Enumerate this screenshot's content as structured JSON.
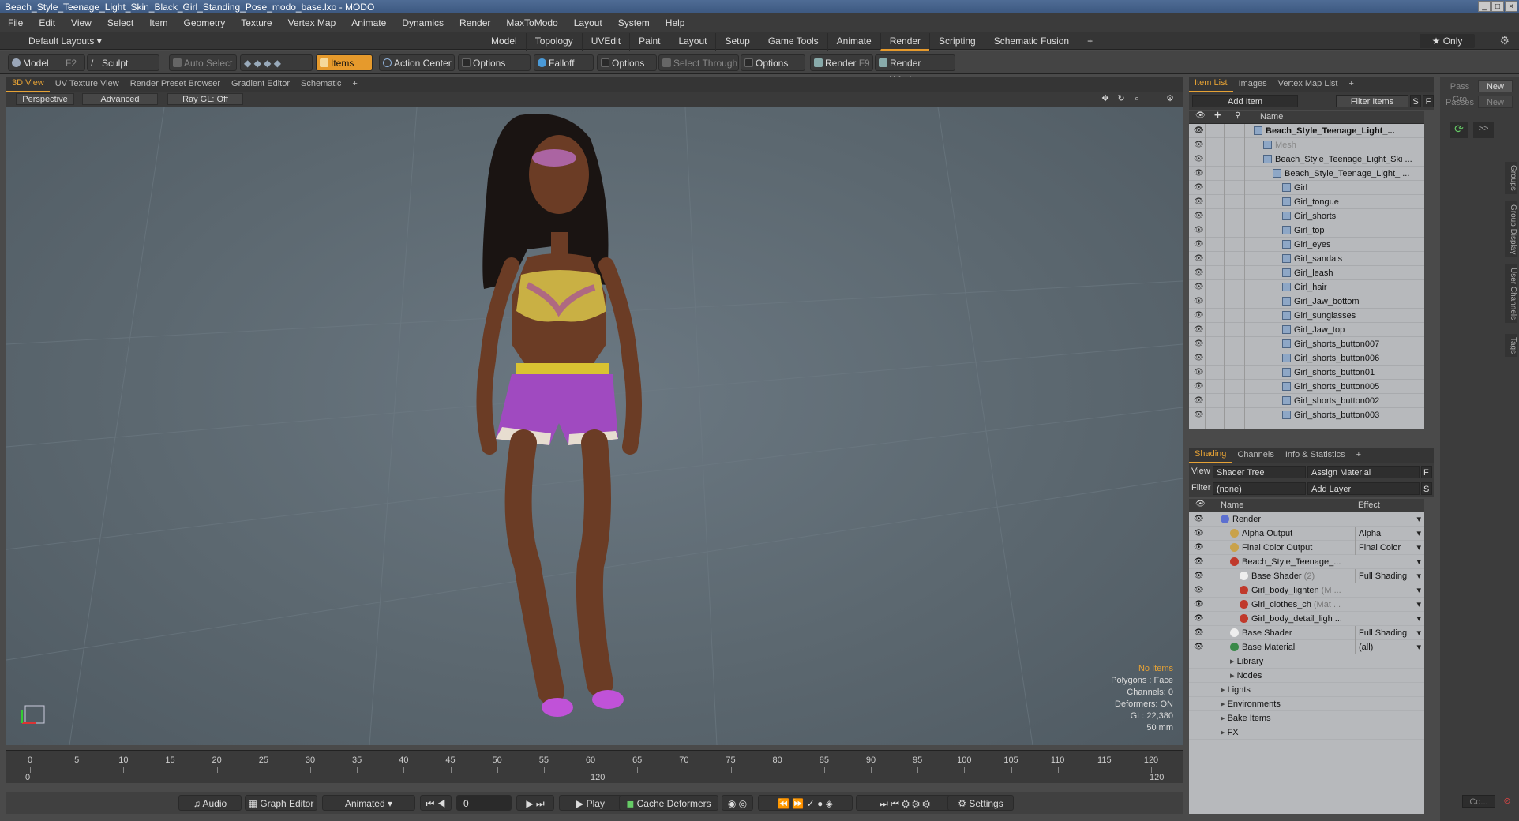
{
  "window": {
    "title": "Beach_Style_Teenage_Light_Skin_Black_Girl_Standing_Pose_modo_base.lxo - MODO"
  },
  "menu": [
    "File",
    "Edit",
    "View",
    "Select",
    "Item",
    "Geometry",
    "Texture",
    "Vertex Map",
    "Animate",
    "Dynamics",
    "Render",
    "MaxToModo",
    "Layout",
    "System",
    "Help"
  ],
  "layout_tabs": {
    "layouts_label": "Default Layouts ▾",
    "tabs": [
      "Model",
      "Topology",
      "UVEdit",
      "Paint",
      "Layout",
      "Setup",
      "Game Tools",
      "Animate",
      "Render",
      "Scripting",
      "Schematic Fusion",
      "+"
    ],
    "active": "Render",
    "only_label": "★ Only"
  },
  "toolbar": {
    "model": "Model",
    "model_key": "F2",
    "sculpt": "Sculpt",
    "auto_select": "Auto Select",
    "items": "Items",
    "action_center": "Action Center",
    "options1": "Options",
    "falloff": "Falloff",
    "options2": "Options",
    "select_through": "Select Through",
    "options3": "Options",
    "render": "Render",
    "render_key": "F9",
    "render_window": "Render Window"
  },
  "viewport": {
    "tabs": [
      "3D View",
      "UV Texture View",
      "Render Preset Browser",
      "Gradient Editor",
      "Schematic",
      "+"
    ],
    "active_tab": "3D View",
    "view_mode": "Perspective",
    "advanced": "Advanced",
    "raygl": "Ray GL: Off",
    "info": {
      "selection": "No Items",
      "polygons": "Polygons : Face",
      "channels": "Channels: 0",
      "deformers": "Deformers: ON",
      "gl": "GL: 22,380",
      "focal": "50 mm"
    }
  },
  "timeline": {
    "ticks": [
      0,
      5,
      10,
      15,
      20,
      25,
      30,
      35,
      40,
      45,
      50,
      55,
      60,
      65,
      70,
      75,
      80,
      85,
      90,
      95,
      100,
      105,
      110,
      115,
      120
    ],
    "range_start": "0",
    "range_mid": "120",
    "range_end": "120"
  },
  "playbar": {
    "audio": "Audio",
    "graph_editor": "Graph Editor",
    "animated": "Animated",
    "frame": "0",
    "play": "Play",
    "cache_deformers": "Cache Deformers",
    "settings": "Settings"
  },
  "item_list": {
    "tabs": [
      "Item List",
      "Images",
      "Vertex Map List",
      "+"
    ],
    "active_tab": "Item List",
    "add_item": "Add Item",
    "filter_items": "Filter Items",
    "s_btn": "S",
    "f_btn": "F",
    "col_name": "Name",
    "rows": [
      {
        "label": "Beach_Style_Teenage_Light_...",
        "depth": 0,
        "style": "b"
      },
      {
        "label": "Mesh",
        "depth": 1,
        "style": "d"
      },
      {
        "label": "Beach_Style_Teenage_Light_Ski ...",
        "depth": 1,
        "style": ""
      },
      {
        "label": "Beach_Style_Teenage_Light_ ...",
        "depth": 2,
        "style": ""
      },
      {
        "label": "Girl",
        "depth": 3,
        "style": ""
      },
      {
        "label": "Girl_tongue",
        "depth": 3,
        "style": ""
      },
      {
        "label": "Girl_shorts",
        "depth": 3,
        "style": ""
      },
      {
        "label": "Girl_top",
        "depth": 3,
        "style": ""
      },
      {
        "label": "Girl_eyes",
        "depth": 3,
        "style": ""
      },
      {
        "label": "Girl_sandals",
        "depth": 3,
        "style": ""
      },
      {
        "label": "Girl_leash",
        "depth": 3,
        "style": ""
      },
      {
        "label": "Girl_hair",
        "depth": 3,
        "style": ""
      },
      {
        "label": "Girl_Jaw_bottom",
        "depth": 3,
        "style": ""
      },
      {
        "label": "Girl_sunglasses",
        "depth": 3,
        "style": ""
      },
      {
        "label": "Girl_Jaw_top",
        "depth": 3,
        "style": ""
      },
      {
        "label": "Girl_shorts_button007",
        "depth": 3,
        "style": ""
      },
      {
        "label": "Girl_shorts_button006",
        "depth": 3,
        "style": ""
      },
      {
        "label": "Girl_shorts_button01",
        "depth": 3,
        "style": ""
      },
      {
        "label": "Girl_shorts_button005",
        "depth": 3,
        "style": ""
      },
      {
        "label": "Girl_shorts_button002",
        "depth": 3,
        "style": ""
      },
      {
        "label": "Girl_shorts_button003",
        "depth": 3,
        "style": ""
      }
    ]
  },
  "shading": {
    "tabs": [
      "Shading",
      "Channels",
      "Info & Statistics",
      "+"
    ],
    "active_tab": "Shading",
    "view_label": "View",
    "view_value": "Shader Tree",
    "assign_material": "Assign Material",
    "f_btn": "F",
    "filter_label": "Filter",
    "filter_value": "(none)",
    "add_layer": "Add Layer",
    "s_btn": "S",
    "col_name": "Name",
    "col_effect": "Effect",
    "rows": [
      {
        "label": "Render",
        "sub": "",
        "effect": "",
        "depth": 0,
        "ball": "#5b6fd0"
      },
      {
        "label": "Alpha Output",
        "sub": "",
        "effect": "Alpha",
        "depth": 1,
        "ball": "#c9a24a"
      },
      {
        "label": "Final Color Output",
        "sub": "",
        "effect": "Final Color",
        "depth": 1,
        "ball": "#c9a24a"
      },
      {
        "label": "Beach_Style_Teenage_...",
        "sub": "",
        "effect": "",
        "depth": 1,
        "ball": "#c0392b"
      },
      {
        "label": "Base Shader",
        "sub": "(2)",
        "effect": "Full Shading",
        "depth": 2,
        "ball": "#eeeeee"
      },
      {
        "label": "Girl_body_lighten",
        "sub": "(M ...",
        "effect": "",
        "depth": 2,
        "ball": "#c0392b"
      },
      {
        "label": "Girl_clothes_ch",
        "sub": "(Mat ...",
        "effect": "",
        "depth": 2,
        "ball": "#c0392b"
      },
      {
        "label": "Girl_body_detail_ligh ...",
        "sub": "",
        "effect": "",
        "depth": 2,
        "ball": "#c0392b"
      },
      {
        "label": "Base Shader",
        "sub": "",
        "effect": "Full Shading",
        "depth": 1,
        "ball": "#eeeeee"
      },
      {
        "label": "Base Material",
        "sub": "",
        "effect": "(all)",
        "depth": 1,
        "ball": "#3b8a4a"
      },
      {
        "label": "Library",
        "sub": "",
        "effect": "",
        "depth": 1,
        "ball": ""
      },
      {
        "label": "Nodes",
        "sub": "",
        "effect": "",
        "depth": 1,
        "ball": ""
      },
      {
        "label": "Lights",
        "sub": "",
        "effect": "",
        "depth": 0,
        "ball": ""
      },
      {
        "label": "Environments",
        "sub": "",
        "effect": "",
        "depth": 0,
        "ball": ""
      },
      {
        "label": "Bake Items",
        "sub": "",
        "effect": "",
        "depth": 0,
        "ball": ""
      },
      {
        "label": "FX",
        "sub": "",
        "effect": "",
        "depth": 0,
        "ball": ""
      }
    ]
  },
  "far_right": {
    "pass_group": "Pass Gro",
    "new1": "New",
    "passes": "Passes",
    "new2": "New",
    "arrows": ">>",
    "vtabs": [
      "Groups",
      "Group Display",
      "User Channels",
      "Tags"
    ],
    "co_btn": "Co..."
  },
  "colors": {
    "accent": "#e69a2c",
    "title_bar": "#4a6790",
    "list_bg": "#b7b9bc"
  }
}
